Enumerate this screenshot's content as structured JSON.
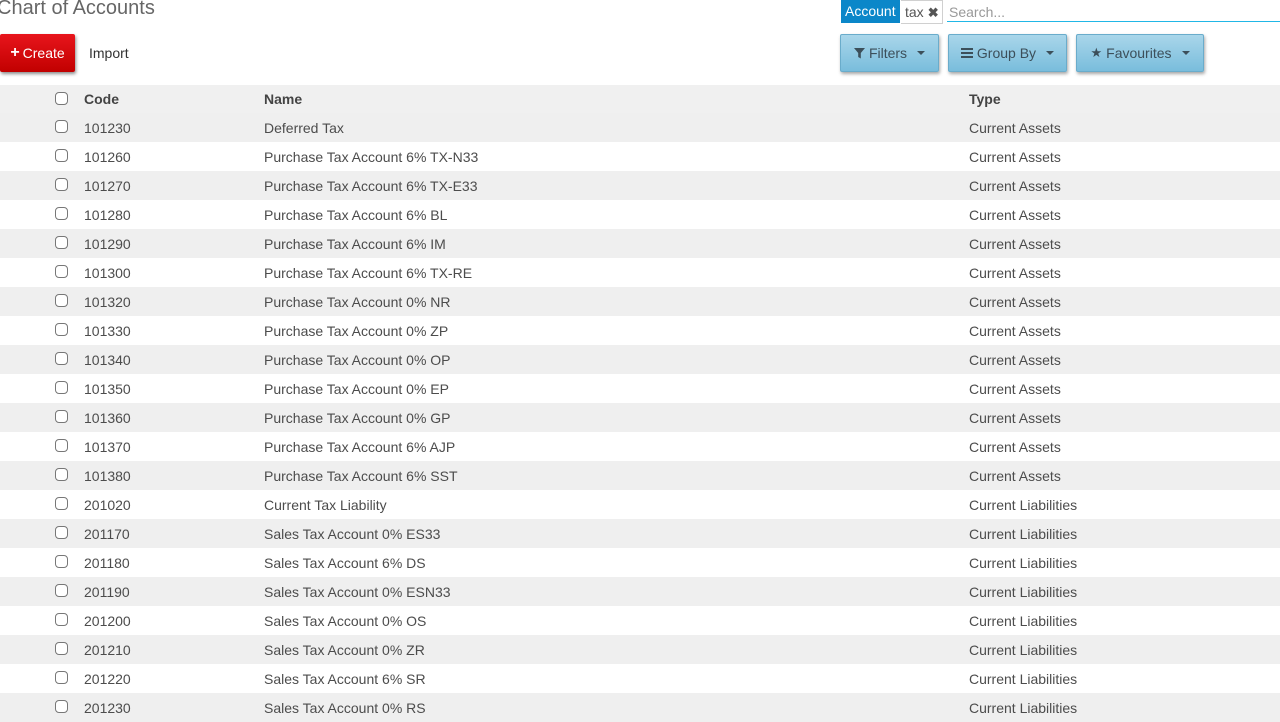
{
  "page": {
    "title": "Chart of Accounts"
  },
  "toolbar": {
    "create_label": "Create",
    "import_label": "Import"
  },
  "search": {
    "facet_category": "Account",
    "facet_value": "tax",
    "placeholder": "Search...",
    "filters_label": "Filters",
    "groupby_label": "Group By",
    "favourites_label": "Favourites"
  },
  "table": {
    "headers": {
      "code": "Code",
      "name": "Name",
      "type": "Type"
    },
    "rows": [
      {
        "code": "101230",
        "name": "Deferred Tax",
        "type": "Current Assets"
      },
      {
        "code": "101260",
        "name": "Purchase Tax Account 6% TX-N33",
        "type": "Current Assets"
      },
      {
        "code": "101270",
        "name": "Purchase Tax Account 6% TX-E33",
        "type": "Current Assets"
      },
      {
        "code": "101280",
        "name": "Purchase Tax Account 6% BL",
        "type": "Current Assets"
      },
      {
        "code": "101290",
        "name": "Purchase Tax Account 6% IM",
        "type": "Current Assets"
      },
      {
        "code": "101300",
        "name": "Purchase Tax Account 6% TX-RE",
        "type": "Current Assets"
      },
      {
        "code": "101320",
        "name": "Purchase Tax Account 0% NR",
        "type": "Current Assets"
      },
      {
        "code": "101330",
        "name": "Purchase Tax Account 0% ZP",
        "type": "Current Assets"
      },
      {
        "code": "101340",
        "name": "Purchase Tax Account 0% OP",
        "type": "Current Assets"
      },
      {
        "code": "101350",
        "name": "Purchase Tax Account 0% EP",
        "type": "Current Assets"
      },
      {
        "code": "101360",
        "name": "Purchase Tax Account 0% GP",
        "type": "Current Assets"
      },
      {
        "code": "101370",
        "name": "Purchase Tax Account 6% AJP",
        "type": "Current Assets"
      },
      {
        "code": "101380",
        "name": "Purchase Tax Account 6% SST",
        "type": "Current Assets"
      },
      {
        "code": "201020",
        "name": "Current Tax Liability",
        "type": "Current Liabilities"
      },
      {
        "code": "201170",
        "name": "Sales Tax Account 0% ES33",
        "type": "Current Liabilities"
      },
      {
        "code": "201180",
        "name": "Sales Tax Account 6% DS",
        "type": "Current Liabilities"
      },
      {
        "code": "201190",
        "name": "Sales Tax Account 0% ESN33",
        "type": "Current Liabilities"
      },
      {
        "code": "201200",
        "name": "Sales Tax Account 0% OS",
        "type": "Current Liabilities"
      },
      {
        "code": "201210",
        "name": "Sales Tax Account 0% ZR",
        "type": "Current Liabilities"
      },
      {
        "code": "201220",
        "name": "Sales Tax Account 6% SR",
        "type": "Current Liabilities"
      },
      {
        "code": "201230",
        "name": "Sales Tax Account 0% RS",
        "type": "Current Liabilities"
      }
    ]
  }
}
